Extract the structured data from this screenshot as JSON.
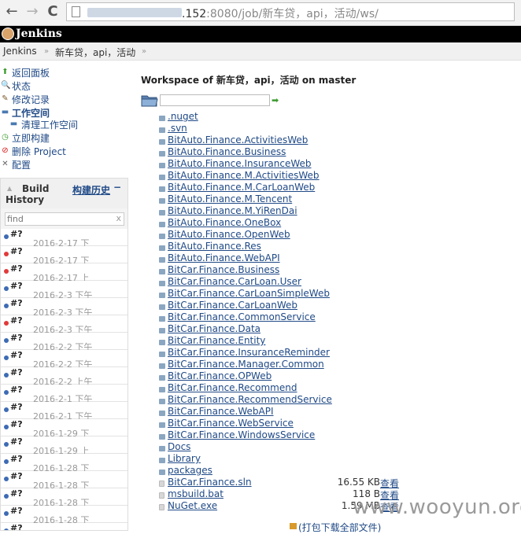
{
  "browser": {
    "back_glyph": "←",
    "forward_glyph": "→",
    "reload_glyph": "C",
    "url_host_suffix": ".152",
    "url_rest": ":8080/job/新车贷，api，活动/ws/"
  },
  "header": {
    "app_title": "Jenkins"
  },
  "breadcrumbs": {
    "root": "Jenkins",
    "job": "新车贷，api，活动",
    "sep": "»"
  },
  "sidebar": {
    "tasks": [
      {
        "label": "返回面板",
        "icon": "up-arrow-icon",
        "glyph": "⬆",
        "color": "#3a9a2c"
      },
      {
        "label": "状态",
        "icon": "search-icon",
        "glyph": "🔍",
        "color": "#4a6fa5"
      },
      {
        "label": "修改记录",
        "icon": "notepad-icon",
        "glyph": "✎",
        "color": "#7a5a2a"
      },
      {
        "label": "工作空间",
        "icon": "folder-icon",
        "glyph": "▬",
        "color": "#4a7ab0"
      },
      {
        "label": "清理工作空间",
        "icon": "folder-delete-icon",
        "glyph": "▬",
        "color": "#4a7ab0"
      },
      {
        "label": "立即构建",
        "icon": "clock-icon",
        "glyph": "◷",
        "color": "#3a9a2c"
      },
      {
        "label": "删除 Project",
        "icon": "no-entry-icon",
        "glyph": "⊘",
        "color": "#d11"
      },
      {
        "label": "配置",
        "icon": "wrench-icon",
        "glyph": "✕",
        "color": "#666"
      }
    ]
  },
  "build_history": {
    "title_line1": "Build",
    "title_line2": "History",
    "trend_label": "构建历史",
    "collapse_glyph": "−",
    "filter_placeholder": "find",
    "clear_glyph": "x",
    "builds": [
      {
        "num": "#?",
        "date": "2016-2-17 下",
        "status": "blue"
      },
      {
        "num": "#?",
        "date": "2016-2-17 下",
        "status": "red"
      },
      {
        "num": "#?",
        "date": "2016-2-17 上",
        "status": "red"
      },
      {
        "num": "#?",
        "date": "2016-2-3 下午",
        "status": "blue"
      },
      {
        "num": "#?",
        "date": "2016-2-3 下午",
        "status": "blue"
      },
      {
        "num": "#?",
        "date": "2016-2-3 下午",
        "status": "red"
      },
      {
        "num": "#?",
        "date": "2016-2-2 下午",
        "status": "blue"
      },
      {
        "num": "#?",
        "date": "2016-2-2 下午",
        "status": "blue"
      },
      {
        "num": "#?",
        "date": "2016-2-2 上午",
        "status": "blue"
      },
      {
        "num": "#?",
        "date": "2016-2-1 下午",
        "status": "blue"
      },
      {
        "num": "#?",
        "date": "2016-2-1 下午",
        "status": "blue"
      },
      {
        "num": "#?",
        "date": "2016-1-29 下",
        "status": "blue"
      },
      {
        "num": "#?",
        "date": "2016-1-29 上",
        "status": "blue"
      },
      {
        "num": "#?",
        "date": "2016-1-28 下",
        "status": "blue"
      },
      {
        "num": "#?",
        "date": "2016-1-28 下",
        "status": "blue"
      },
      {
        "num": "#?",
        "date": "2016-1-28 下",
        "status": "blue"
      },
      {
        "num": "#?",
        "date": "2016-1-28 下",
        "status": "blue"
      },
      {
        "num": "#?",
        "date": "",
        "status": "blue"
      }
    ]
  },
  "workspace": {
    "heading": "Workspace of 新车贷，api，活动 on master",
    "path_value": "",
    "entries": [
      {
        "name": ".nuget",
        "type": "dir"
      },
      {
        "name": ".svn",
        "type": "dir"
      },
      {
        "name": "BitAuto.Finance.ActivitiesWeb",
        "type": "dir"
      },
      {
        "name": "BitAuto.Finance.Business",
        "type": "dir"
      },
      {
        "name": "BitAuto.Finance.InsuranceWeb",
        "type": "dir"
      },
      {
        "name": "BitAuto.Finance.M.ActivitiesWeb",
        "type": "dir"
      },
      {
        "name": "BitAuto.Finance.M.CarLoanWeb",
        "type": "dir"
      },
      {
        "name": "BitAuto.Finance.M.Tencent",
        "type": "dir"
      },
      {
        "name": "BitAuto.Finance.M.YiRenDai",
        "type": "dir"
      },
      {
        "name": "BitAuto.Finance.OneBox",
        "type": "dir"
      },
      {
        "name": "BitAuto.Finance.OpenWeb",
        "type": "dir"
      },
      {
        "name": "BitAuto.Finance.Res",
        "type": "dir"
      },
      {
        "name": "BitAuto.Finance.WebAPI",
        "type": "dir"
      },
      {
        "name": "BitCar.Finance.Business",
        "type": "dir"
      },
      {
        "name": "BitCar.Finance.CarLoan.User",
        "type": "dir"
      },
      {
        "name": "BitCar.Finance.CarLoanSimpleWeb",
        "type": "dir"
      },
      {
        "name": "BitCar.Finance.CarLoanWeb",
        "type": "dir"
      },
      {
        "name": "BitCar.Finance.CommonService",
        "type": "dir"
      },
      {
        "name": "BitCar.Finance.Data",
        "type": "dir"
      },
      {
        "name": "BitCar.Finance.Entity",
        "type": "dir"
      },
      {
        "name": "BitCar.Finance.InsuranceReminder",
        "type": "dir"
      },
      {
        "name": "BitCar.Finance.Manager.Common",
        "type": "dir"
      },
      {
        "name": "BitCar.Finance.OPWeb",
        "type": "dir"
      },
      {
        "name": "BitCar.Finance.Recommend",
        "type": "dir"
      },
      {
        "name": "BitCar.Finance.RecommendService",
        "type": "dir"
      },
      {
        "name": "BitCar.Finance.WebAPI",
        "type": "dir"
      },
      {
        "name": "BitCar.Finance.WebService",
        "type": "dir"
      },
      {
        "name": "BitCar.Finance.WindowsService",
        "type": "dir"
      },
      {
        "name": "Docs",
        "type": "dir"
      },
      {
        "name": "Library",
        "type": "dir"
      },
      {
        "name": "packages",
        "type": "dir"
      },
      {
        "name": "BitCar.Finance.sln",
        "type": "file",
        "size": "16.55 KB",
        "view": "查看"
      },
      {
        "name": "msbuild.bat",
        "type": "file",
        "size": "118 B",
        "view": "查看"
      },
      {
        "name": "NuGet.exe",
        "type": "file",
        "size": "1.59 MB",
        "view": "查看"
      }
    ],
    "zip_link": "(打包下载全部文件)"
  },
  "watermark": "www.wooyun.org",
  "colors": {
    "link": "#204a87",
    "blue_ball": "#3d6bb4",
    "red_ball": "#e23a3a"
  }
}
